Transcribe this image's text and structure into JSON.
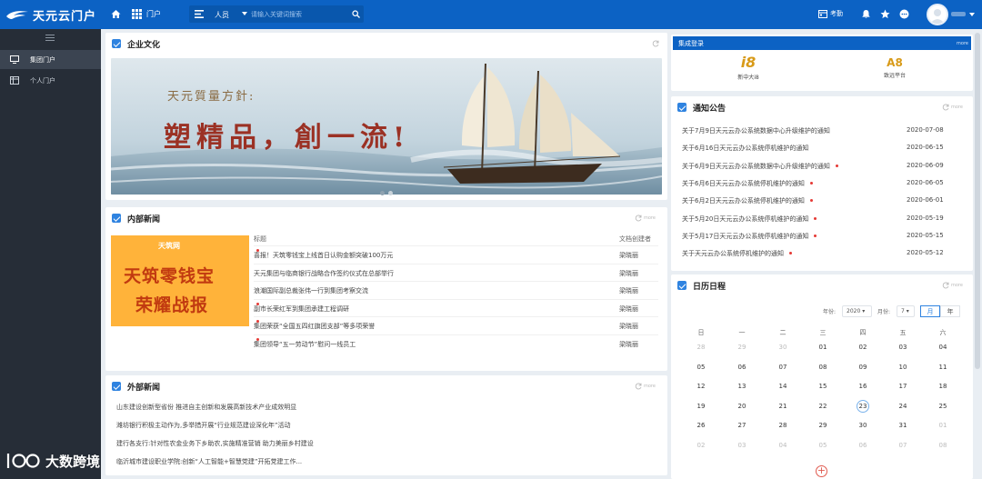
{
  "app": {
    "title": "天元云门户"
  },
  "topbar": {
    "portal_label": "门户",
    "search_scope": "人员",
    "search_placeholder": "请输入关键词搜索",
    "attendance_label": "考勤"
  },
  "sidebar": {
    "items": [
      {
        "label": "集团门户"
      },
      {
        "label": "个人门户"
      }
    ]
  },
  "culture": {
    "title": "企业文化",
    "slogan_line1": "天元質量方針:",
    "slogan_line2": "塑精品，創一流!"
  },
  "internal_news": {
    "title": "内部新闻",
    "more": "more",
    "col_title": "标题",
    "col_author": "文档创建者",
    "promo_brand": "天筑网",
    "promo_line1": "天筑零钱宝",
    "promo_line2": "荣耀战报",
    "rows": [
      {
        "title": "喜报！天筑零钱宝上线首日认购金额突破100万元",
        "author": "梁晓丽",
        "new": true
      },
      {
        "title": "天元集团与临商银行战略合作签约仪式在总部举行",
        "author": "梁晓丽",
        "new": false
      },
      {
        "title": "浪潮国际副总裁张伟一行到集团考察交流",
        "author": "梁晓丽",
        "new": false
      },
      {
        "title": "副市长荣红军到集团承建工程调研",
        "author": "梁晓丽",
        "new": true
      },
      {
        "title": "集团荣获“全国五四红旗团支部”等多项荣誉",
        "author": "梁晓丽",
        "new": true
      },
      {
        "title": "集团领导“五一劳动节”慰问一线员工",
        "author": "梁晓丽",
        "new": true
      }
    ]
  },
  "external_news": {
    "title": "外部新闻",
    "more": "more",
    "rows": [
      "山东建设创新型省份 推进自主创新和发展高新技术产业成效明显",
      "潍坊银行积极主动作为,多举措开展“行业规范建设深化年”活动",
      "建行各支行:针对性农金业务下乡助农,实施精准营销 助力美丽乡村建设",
      "临沂城市建设职业学院:创新“人工智能+智慧党建”开拓党建工作..."
    ]
  },
  "quick_login": {
    "title": "集成登录",
    "more": "more",
    "apps": [
      {
        "icon": "i8",
        "label": "新中大i8"
      },
      {
        "icon": "A8",
        "label": "致远平台"
      }
    ]
  },
  "notices": {
    "title": "通知公告",
    "more": "more",
    "rows": [
      {
        "title": "关于7月9日天元云办公系统数据中心升级维护的通知",
        "date": "2020-07-08",
        "new": false
      },
      {
        "title": "关于6月16日天元云办公系统停机维护的通知",
        "date": "2020-06-15",
        "new": false
      },
      {
        "title": "关于6月9日天元云办公系统数据中心升级维护的通知",
        "date": "2020-06-09",
        "new": true
      },
      {
        "title": "关于6月6日天元云办公系统停机维护的通知",
        "date": "2020-06-05",
        "new": true
      },
      {
        "title": "关于6月2日天元云办公系统停机维护的通知",
        "date": "2020-06-01",
        "new": true
      },
      {
        "title": "关于5月20日天元云办公系统停机维护的通知",
        "date": "2020-05-19",
        "new": true
      },
      {
        "title": "关于5月17日天元云办公系统停机维护的通知",
        "date": "2020-05-15",
        "new": true
      },
      {
        "title": "关于天元云办公系统停机维护的通知",
        "date": "2020-05-12",
        "new": true
      }
    ]
  },
  "calendar": {
    "title": "日历日程",
    "more": "more",
    "year_label": "年份:",
    "year": "2020",
    "month_label": "月份:",
    "month": "7",
    "view_month": "月",
    "view_year": "年",
    "weekdays": [
      "日",
      "一",
      "二",
      "三",
      "四",
      "五",
      "六"
    ],
    "weeks": [
      [
        "28",
        "29",
        "30",
        "01",
        "02",
        "03",
        "04"
      ],
      [
        "05",
        "06",
        "07",
        "08",
        "09",
        "10",
        "11"
      ],
      [
        "12",
        "13",
        "14",
        "15",
        "16",
        "17",
        "18"
      ],
      [
        "19",
        "20",
        "21",
        "22",
        "23",
        "24",
        "25"
      ],
      [
        "26",
        "27",
        "28",
        "29",
        "30",
        "31",
        "01"
      ],
      [
        "02",
        "03",
        "04",
        "05",
        "06",
        "07",
        "08"
      ]
    ]
  },
  "watermark": {
    "text": "大数跨境"
  },
  "colors": {
    "brand": "#0c62c4",
    "sidebar": "#262d37",
    "accent": "#2f83e0",
    "new_dot": "#e53935"
  }
}
